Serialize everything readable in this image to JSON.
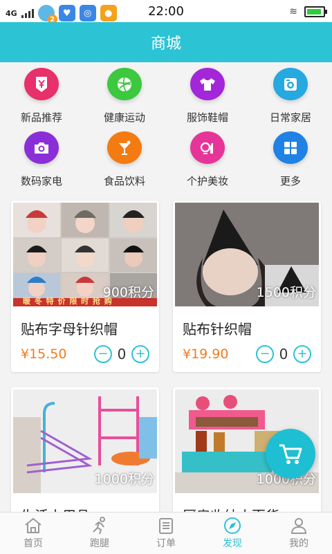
{
  "status_bar": {
    "network": "4G",
    "badge_count": "2",
    "time": "22:00"
  },
  "title": "商城",
  "categories": [
    {
      "label": "新品推荐",
      "icon": "new-arrival-icon",
      "color": "#e8306a"
    },
    {
      "label": "健康运动",
      "icon": "sports-ball-icon",
      "color": "#3cc83f"
    },
    {
      "label": "服饰鞋帽",
      "icon": "tshirt-icon",
      "color": "#a326d8"
    },
    {
      "label": "日常家居",
      "icon": "home-appliance-icon",
      "color": "#26a8e0"
    },
    {
      "label": "数码家电",
      "icon": "camera-icon",
      "color": "#8a2fd8"
    },
    {
      "label": "食品饮料",
      "icon": "drink-icon",
      "color": "#f47a12"
    },
    {
      "label": "个护美妆",
      "icon": "cosmetics-icon",
      "color": "#e63598"
    },
    {
      "label": "更多",
      "icon": "grid-more-icon",
      "color": "#1f82e4"
    }
  ],
  "products": [
    {
      "name": "贴布字母针织帽",
      "price": "¥15.50",
      "points": "900积分",
      "qty": "0",
      "banner": "暖 冬 特 价    限 时 抢 购"
    },
    {
      "name": "贴布针织帽",
      "price": "¥19.90",
      "points": "1500积分",
      "qty": "0"
    },
    {
      "name": "生活小用品",
      "points": "1000积分"
    },
    {
      "name": "厨房收纳小百货",
      "points": "1000积分"
    }
  ],
  "tabs": [
    {
      "label": "首页",
      "icon": "home-icon"
    },
    {
      "label": "跑腿",
      "icon": "runner-icon"
    },
    {
      "label": "订单",
      "icon": "clipboard-icon"
    },
    {
      "label": "发现",
      "icon": "compass-icon",
      "active": true
    },
    {
      "label": "我的",
      "icon": "user-icon"
    }
  ],
  "colors": {
    "accent": "#2cc3d4",
    "price": "#f57a1c"
  }
}
